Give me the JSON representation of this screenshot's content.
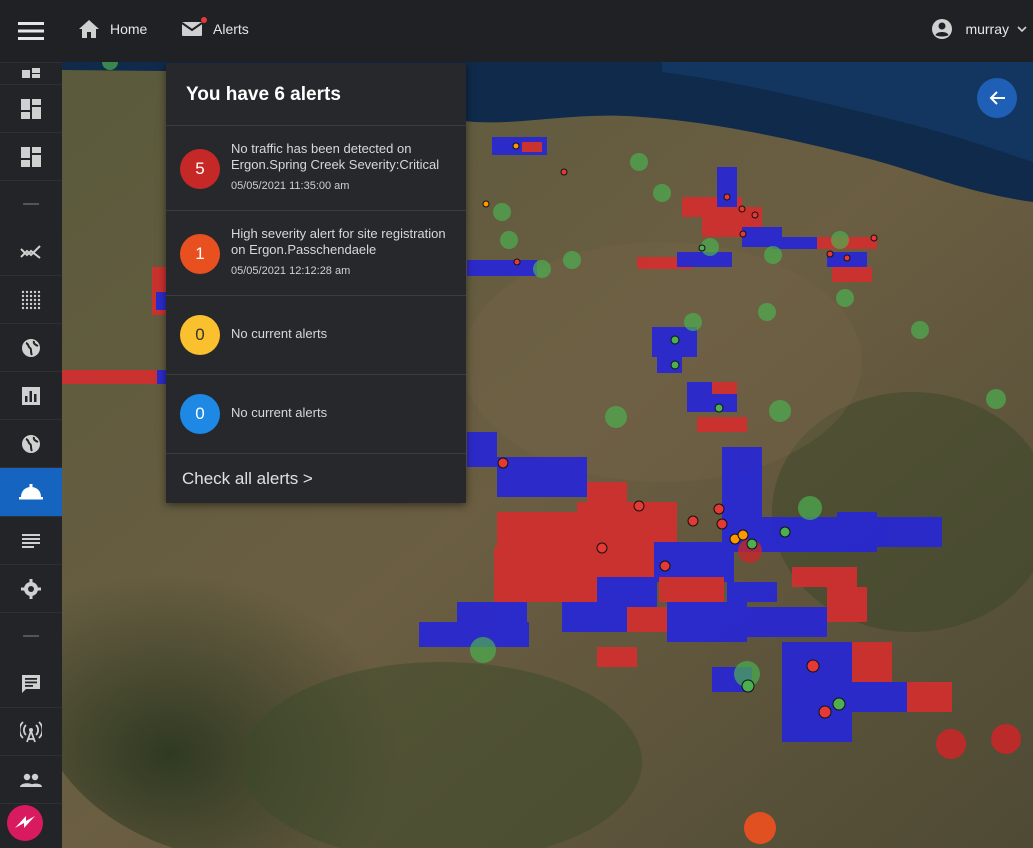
{
  "topbar": {
    "home_label": "Home",
    "alerts_label": "Alerts",
    "username": "murray"
  },
  "sidebar": {
    "items": [
      {
        "icon": "dashboard-icon"
      },
      {
        "icon": "dashboard-icon"
      },
      {
        "icon": "trending-icon"
      },
      {
        "icon": "dots-grid-icon"
      },
      {
        "icon": "globe-icon"
      },
      {
        "icon": "bar-chart-icon"
      },
      {
        "icon": "globe-icon"
      },
      {
        "icon": "bell-icon",
        "active": true
      },
      {
        "icon": "list-icon"
      },
      {
        "icon": "gear-icon"
      },
      {
        "icon": "chat-icon"
      },
      {
        "icon": "antenna-icon"
      },
      {
        "icon": "people-icon"
      }
    ]
  },
  "alerts": {
    "title": "You have 6 alerts",
    "items": [
      {
        "count": "5",
        "color": "#c62828",
        "message": "No traffic has been detected on Ergon.Spring Creek Severity:Critical",
        "time": "05/05/2021 11:35:00 am"
      },
      {
        "count": "1",
        "color": "#e8501f",
        "message": "High severity alert for site registration on Ergon.Passchendaele",
        "time": "05/05/2021 12:12:28 am"
      },
      {
        "count": "0",
        "color": "#fbc02d",
        "message": "No current alerts",
        "time": ""
      },
      {
        "count": "0",
        "color": "#1e88e5",
        "message": "No current alerts",
        "time": ""
      }
    ],
    "check_all": "Check all alerts >"
  },
  "colors": {
    "accent": "#1565c0",
    "red_region": "#d32f2f",
    "blue_region": "#1f1fd0"
  }
}
